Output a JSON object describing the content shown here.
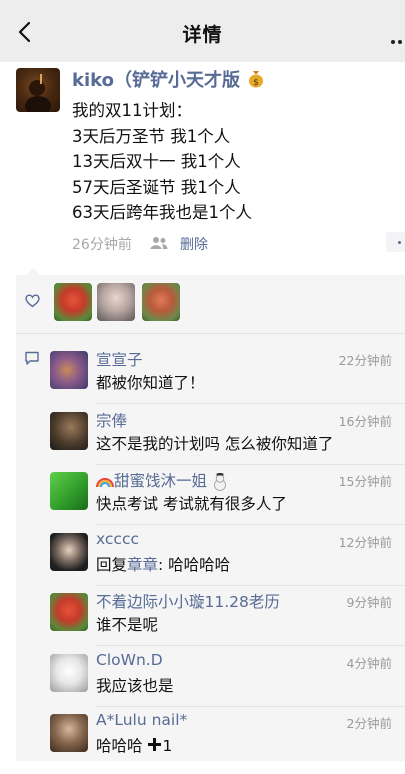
{
  "nav": {
    "title": "详情",
    "back_icon": "chevron-left-icon",
    "more_icon": "more-dots-icon"
  },
  "post": {
    "author": "kiko（铲铲小天才版",
    "author_emoji": "money-bag-icon",
    "lines": [
      "我的双11计划：",
      "3天后万圣节 我1个人",
      "13天后双十一 我1个人",
      "57天后圣诞节 我1个人",
      "63天后跨年我也是1个人"
    ],
    "time": "26分钟前",
    "visibility_icon": "friends-icon",
    "delete_label": "删除"
  },
  "likes": {
    "icon": "heart-outline-icon",
    "count_avatars": 3
  },
  "comments_icon": "comment-bubble-icon",
  "comments": [
    {
      "name": "宣宣子",
      "time": "22分钟前",
      "text": "都被你知道了！"
    },
    {
      "name": "宗俸",
      "time": "16分钟前",
      "text": "这不是我的计划吗 怎么被你知道了"
    },
    {
      "name": "甜蜜饯沐一姐",
      "time": "15分钟前",
      "text": "快点考试  考试就有很多人了"
    },
    {
      "name": "xcccc",
      "time": "12分钟前",
      "reply_prefix": "回复",
      "reply_to": "章章",
      "reply_text": ": 哈哈哈哈"
    },
    {
      "name": "不着边际小小璇11.28老历",
      "time": "9分钟前",
      "text": "谁不是呢"
    },
    {
      "name": "CloWn.D",
      "time": "4分钟前",
      "text": "我应该也是"
    },
    {
      "name": "A*Lulu nail*",
      "time": "2分钟前",
      "text": "哈哈哈",
      "text_suffix": "1"
    }
  ],
  "colors": {
    "link": "#576b95",
    "nav_bg": "#ededed",
    "panel_bg": "#f5f5f5"
  }
}
